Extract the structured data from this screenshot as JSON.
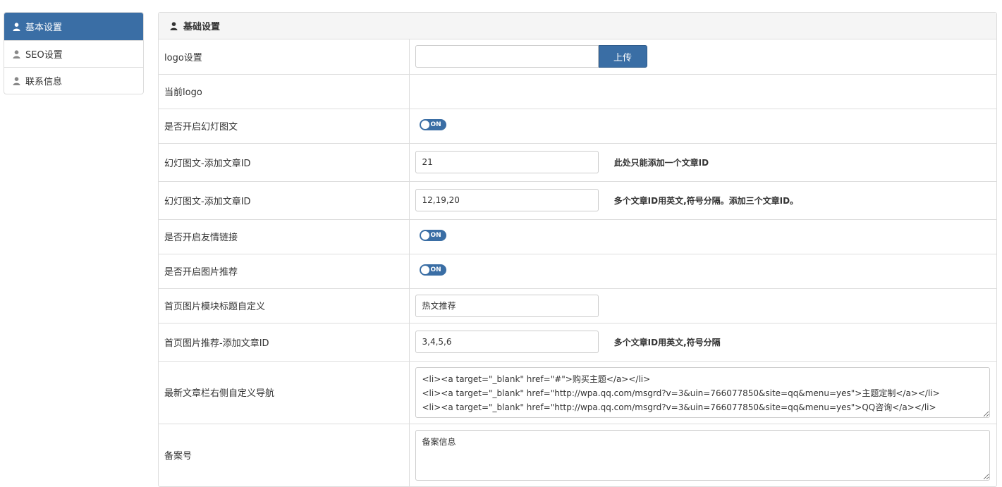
{
  "sidebar": {
    "items": [
      {
        "label": "基本设置",
        "icon": "user-icon",
        "active": true
      },
      {
        "label": "SEO设置",
        "icon": "user-icon",
        "active": false
      },
      {
        "label": "联系信息",
        "icon": "user-icon",
        "active": false
      }
    ]
  },
  "panel": {
    "title": "基础设置",
    "rows": {
      "logo": {
        "label": "logo设置",
        "value": "",
        "button": "上传"
      },
      "current_logo": {
        "label": "当前logo"
      },
      "slideshow_toggle": {
        "label": "是否开启幻灯图文",
        "state": "ON"
      },
      "slide_id_1": {
        "label": "幻灯图文-添加文章ID",
        "value": "21",
        "hint": "此处只能添加一个文章ID"
      },
      "slide_id_2": {
        "label": "幻灯图文-添加文章ID",
        "value": "12,19,20",
        "hint": "多个文章ID用英文,符号分隔。添加三个文章ID。"
      },
      "friend_links_toggle": {
        "label": "是否开启友情链接",
        "state": "ON"
      },
      "image_rec_toggle": {
        "label": "是否开启图片推荐",
        "state": "ON"
      },
      "image_module_title": {
        "label": "首页图片模块标题自定义",
        "value": "热文推荐"
      },
      "image_rec_ids": {
        "label": "首页图片推荐-添加文章ID",
        "value": "3,4,5,6",
        "hint": "多个文章ID用英文,符号分隔"
      },
      "custom_nav": {
        "label": "最新文章栏右侧自定义导航",
        "value": "<li><a target=\"_blank\" href=\"#\">购买主题</a></li>\n<li><a target=\"_blank\" href=\"http://wpa.qq.com/msgrd?v=3&uin=766077850&site=qq&menu=yes\">主题定制</a></li>\n<li><a target=\"_blank\" href=\"http://wpa.qq.com/msgrd?v=3&uin=766077850&site=qq&menu=yes\">QQ咨询</a></li>"
      },
      "icp": {
        "label": "备案号",
        "value": "备案信息"
      }
    }
  },
  "colors": {
    "primary": "#3a6ea5",
    "border": "#dddddd",
    "header_bg": "#f5f5f5"
  }
}
